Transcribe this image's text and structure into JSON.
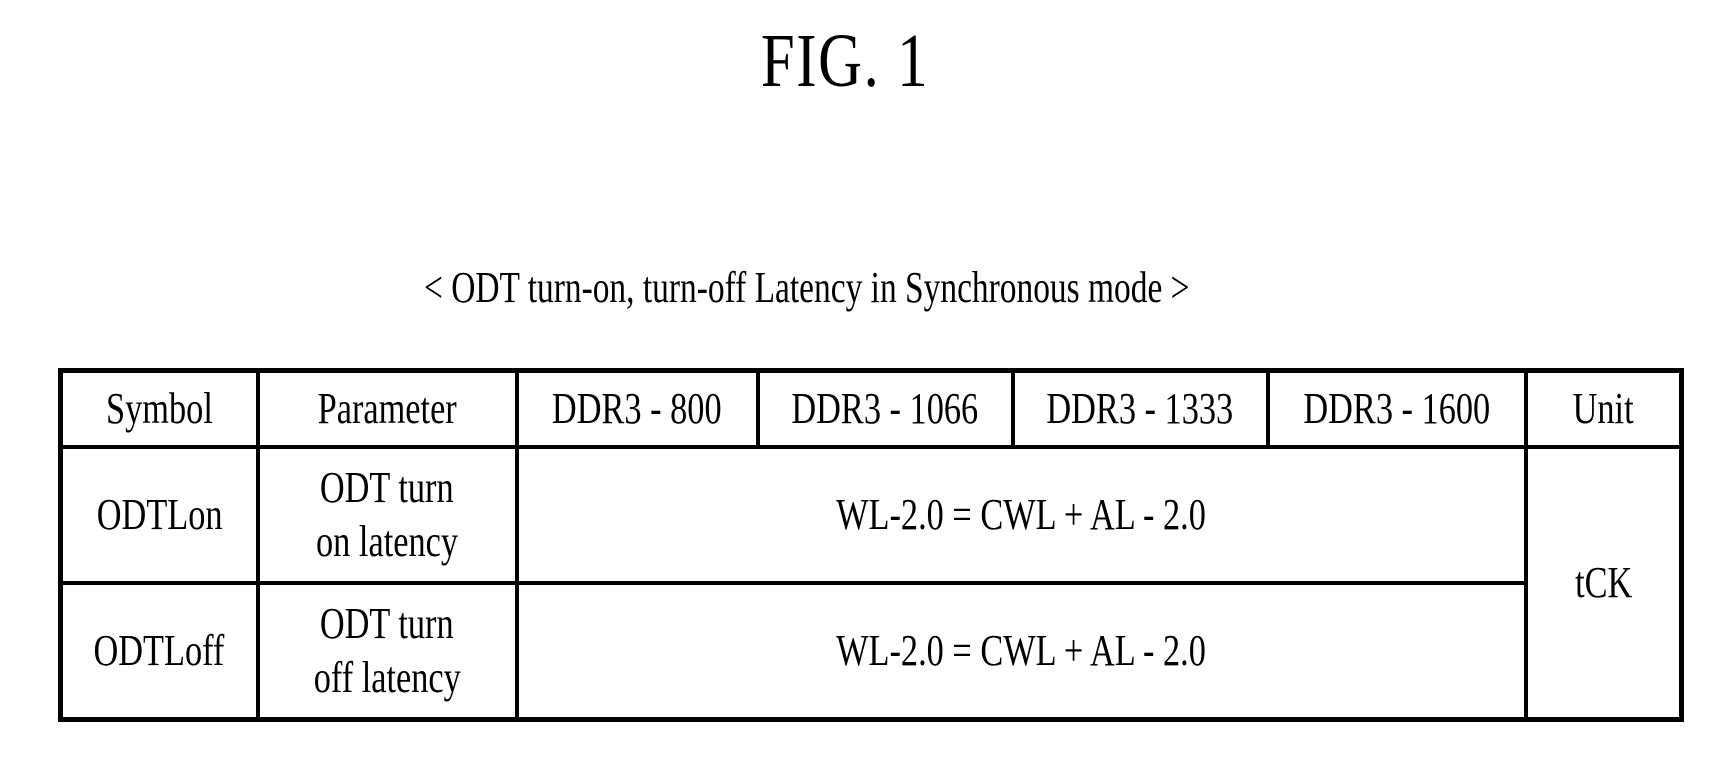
{
  "figure": {
    "title": "FIG. 1",
    "caption": "< ODT turn-on, turn-off Latency in Synchronous mode >"
  },
  "table": {
    "headers": [
      "Symbol",
      "Parameter",
      "DDR3 - 800",
      "DDR3 - 1066",
      "DDR3 - 1333",
      "DDR3 - 1600",
      "Unit"
    ],
    "rows": [
      {
        "symbol": "ODTLon",
        "parameter_line1": "ODT turn",
        "parameter_line2": "on latency",
        "value": "WL-2.0 = CWL + AL - 2.0"
      },
      {
        "symbol": "ODTLoff",
        "parameter_line1": "ODT turn",
        "parameter_line2": "off latency",
        "value": "WL-2.0 = CWL + AL - 2.0"
      }
    ],
    "unit": "tCK"
  }
}
